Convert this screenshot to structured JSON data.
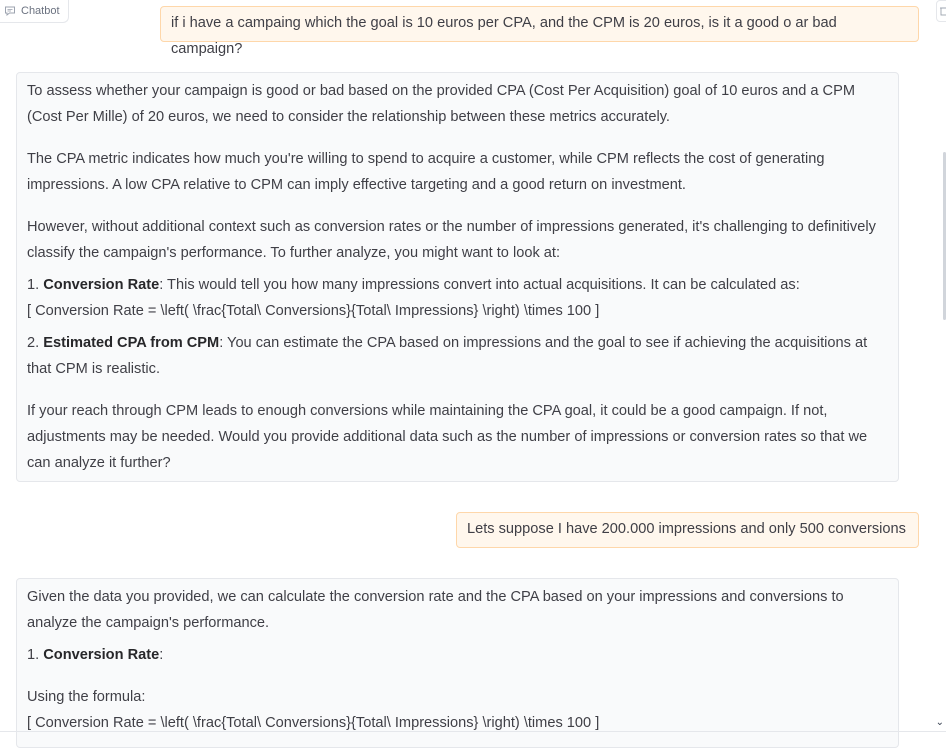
{
  "header": {
    "chatbot_label": "Chatbot",
    "chatbot_icon": "chat-bubble-icon",
    "corner_icon": "trash-icon"
  },
  "messages": [
    {
      "role": "user",
      "text": "if i have a campaing which the goal is 10 euros per CPA, and the CPM is 20 euros, is it a good o ar bad campaign?"
    },
    {
      "role": "bot",
      "p1": "To assess whether your campaign is good or bad based on the provided CPA (Cost Per Acquisition) goal of 10 euros and a CPM (Cost Per Mille) of 20 euros, we need to consider the relationship between these metrics accurately.",
      "p2": "The CPA metric indicates how much you're willing to spend to acquire a customer, while CPM reflects the cost of generating impressions. A low CPA relative to CPM can imply effective targeting and a good return on investment.",
      "p3": "However, without additional context such as conversion rates or the number of impressions generated, it's challenging to definitively classify the campaign's performance. To further analyze, you might want to look at:",
      "item1_num": "1. ",
      "item1_bold": "Conversion Rate",
      "item1_text": ": This would tell you how many impressions convert into actual acquisitions. It can be calculated as:",
      "item1_formula": "[ Conversion Rate = \\left( \\frac{Total\\ Conversions}{Total\\ Impressions} \\right) \\times 100 ]",
      "item2_num": "2. ",
      "item2_bold": "Estimated CPA from CPM",
      "item2_text": ": You can estimate the CPA based on impressions and the goal to see if achieving the acquisitions at that CPM is realistic.",
      "p4": "If your reach through CPM leads to enough conversions while maintaining the CPA goal, it could be a good campaign. If not, adjustments may be needed. Would you provide additional data such as the number of impressions or conversion rates so that we can analyze it further?"
    },
    {
      "role": "user",
      "text": "Lets suppose I have 200.000 impressions and only 500 conversions"
    },
    {
      "role": "bot",
      "p1": "Given the data you provided, we can calculate the conversion rate and the CPA based on your impressions and conversions to analyze the campaign's performance.",
      "item1_num": "1. ",
      "item1_bold": "Conversion Rate",
      "item1_text": ":",
      "p2": "Using the formula:",
      "formula": "[ Conversion Rate = \\left( \\frac{Total\\ Conversions}{Total\\ Impressions} \\right) \\times 100 ]"
    }
  ]
}
